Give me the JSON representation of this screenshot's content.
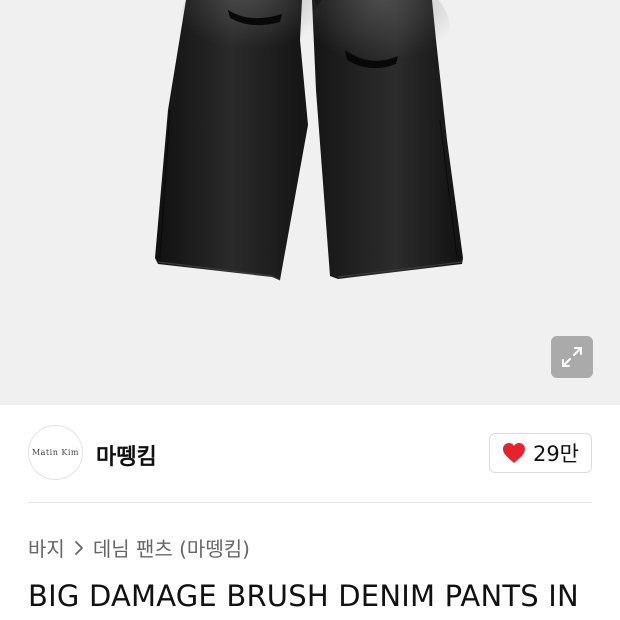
{
  "product_image": {
    "alt": "product-photo"
  },
  "expand": {
    "icon": "expand-arrows-icon"
  },
  "brand": {
    "logo_text": "Matin Kim",
    "name": "마뗑킴"
  },
  "like": {
    "icon": "heart-icon",
    "count": "29만",
    "color": "#e8212b"
  },
  "breadcrumb": {
    "items": [
      "바지",
      "데님 팬츠 (마뗑킴)"
    ]
  },
  "product": {
    "title": "BIG DAMAGE BRUSH DENIM PANTS IN"
  }
}
